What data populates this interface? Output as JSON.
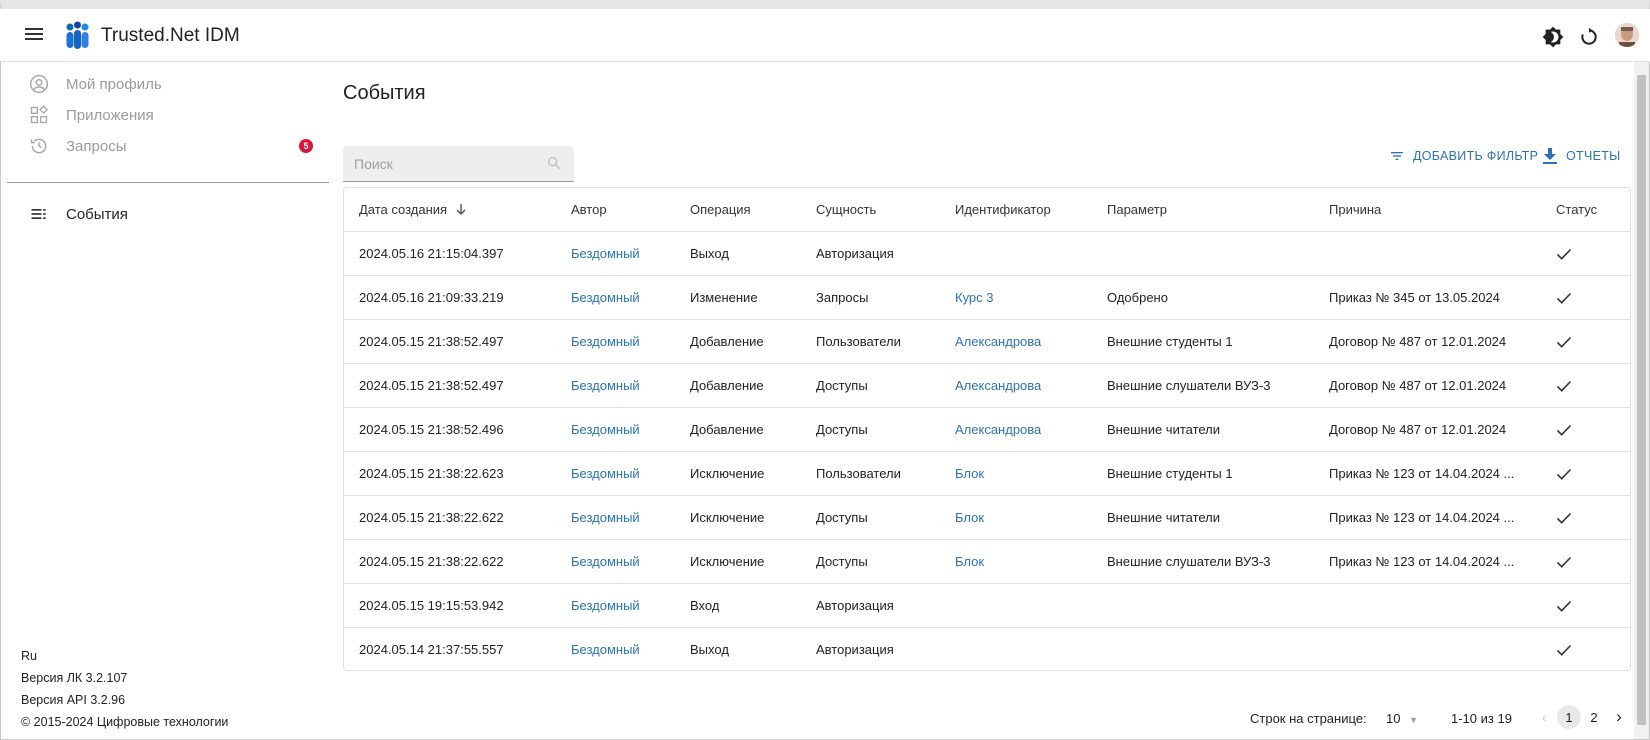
{
  "app": {
    "title": "Trusted.Net IDM"
  },
  "sidebar": {
    "items": [
      {
        "label": "Мой профиль",
        "icon": "account-circle-icon"
      },
      {
        "label": "Приложения",
        "icon": "apps-icon"
      },
      {
        "label": "Запросы",
        "icon": "history-icon",
        "badge": "5"
      }
    ],
    "active_item": {
      "label": "События",
      "icon": "list-icon"
    },
    "footer": {
      "lang": "Ru",
      "version_lk": "Версия ЛК 3.2.107",
      "version_api": "Версия API 3.2.96",
      "copyright": "© 2015-2024 Цифровые технологии"
    }
  },
  "main": {
    "title": "События",
    "search_placeholder": "Поиск",
    "add_filter_label": "ДОБАВИТЬ ФИЛЬТР",
    "reports_label": "ОТЧЕТЫ",
    "columns": [
      "Дата создания",
      "Автор",
      "Операция",
      "Сущность",
      "Идентификатор",
      "Параметр",
      "Причина",
      "Статус"
    ],
    "rows": [
      {
        "date": "2024.05.16 21:15:04.397",
        "author": "Бездомный",
        "operation": "Выход",
        "entity": "Авторизация",
        "id": "",
        "param": "",
        "reason": ""
      },
      {
        "date": "2024.05.16 21:09:33.219",
        "author": "Бездомный",
        "operation": "Изменение",
        "entity": "Запросы",
        "id": "Курс 3",
        "param": "Одобрено",
        "reason": "Приказ № 345 от 13.05.2024"
      },
      {
        "date": "2024.05.15 21:38:52.497",
        "author": "Бездомный",
        "operation": "Добавление",
        "entity": "Пользователи",
        "id": "Александрова",
        "param": "Внешние студенты 1",
        "reason": "Договор № 487 от 12.01.2024"
      },
      {
        "date": "2024.05.15 21:38:52.497",
        "author": "Бездомный",
        "operation": "Добавление",
        "entity": "Доступы",
        "id": "Александрова",
        "param": "Внешние слушатели ВУЗ-3",
        "reason": "Договор № 487 от 12.01.2024"
      },
      {
        "date": "2024.05.15 21:38:52.496",
        "author": "Бездомный",
        "operation": "Добавление",
        "entity": "Доступы",
        "id": "Александрова",
        "param": "Внешние читатели",
        "reason": "Договор № 487 от 12.01.2024"
      },
      {
        "date": "2024.05.15 21:38:22.623",
        "author": "Бездомный",
        "operation": "Исключение",
        "entity": "Пользователи",
        "id": "Блок",
        "param": "Внешние студенты 1",
        "reason": "Приказ № 123 от 14.04.2024 ..."
      },
      {
        "date": "2024.05.15 21:38:22.622",
        "author": "Бездомный",
        "operation": "Исключение",
        "entity": "Доступы",
        "id": "Блок",
        "param": "Внешние читатели",
        "reason": "Приказ № 123 от 14.04.2024 ..."
      },
      {
        "date": "2024.05.15 21:38:22.622",
        "author": "Бездомный",
        "operation": "Исключение",
        "entity": "Доступы",
        "id": "Блок",
        "param": "Внешние слушатели ВУЗ-3",
        "reason": "Приказ № 123 от 14.04.2024 ..."
      },
      {
        "date": "2024.05.15 19:15:53.942",
        "author": "Бездомный",
        "operation": "Вход",
        "entity": "Авторизация",
        "id": "",
        "param": "",
        "reason": ""
      },
      {
        "date": "2024.05.14 21:37:55.557",
        "author": "Бездомный",
        "operation": "Выход",
        "entity": "Авторизация",
        "id": "",
        "param": "",
        "reason": ""
      }
    ],
    "pagination": {
      "rows_per_page_label": "Строк на странице:",
      "rows_per_page_value": "10",
      "range": "1-10 из 19",
      "pages": [
        "1",
        "2"
      ],
      "current_page": "1"
    }
  },
  "colors": {
    "link": "#2b72b8",
    "badge": "#e0153a"
  }
}
